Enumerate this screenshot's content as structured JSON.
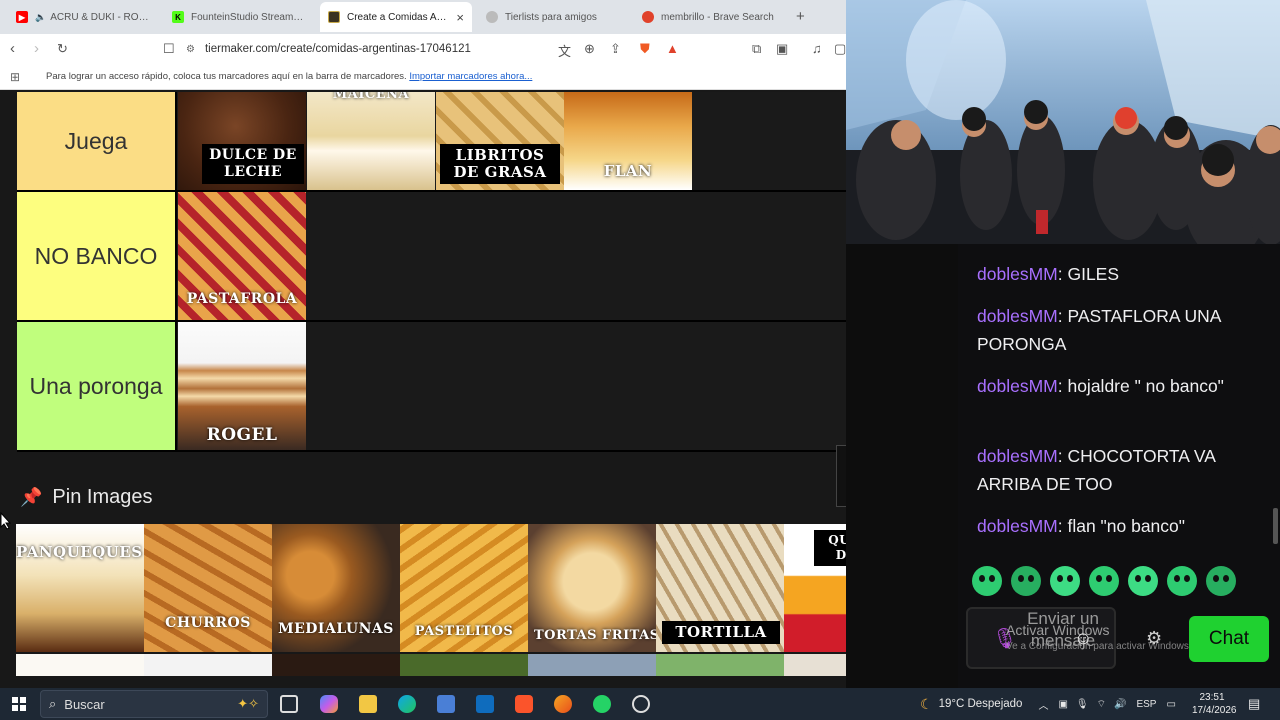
{
  "browser": {
    "tabs": [
      {
        "title": "ACRU & DUKI - ROSA N",
        "favicon_color": "#ff0000",
        "active": false
      },
      {
        "title": "FounteinStudio Stream - W",
        "favicon_color": "#53fc18",
        "active": false
      },
      {
        "title": "Create a Comidas Argen",
        "favicon_color": "#6b5b2e",
        "active": true
      },
      {
        "title": "Tierlists para amigos",
        "favicon_color": "#888888",
        "active": false
      },
      {
        "title": "membrillo - Brave Search",
        "favicon_color": "#e0422b",
        "active": false
      }
    ],
    "new_tab": "+",
    "close_tab": "×",
    "url": "tiermaker.com/create/comidas-argentinas-17046121",
    "bookmarks_hint": "Para lograr un acceso rápido, coloca tus marcadores aquí en la barra de marcadores.",
    "bookmarks_import": "Importar marcadores ahora..."
  },
  "tierlist": {
    "rows": [
      {
        "label": "Juega",
        "color": "#fbdd85",
        "items": [
          "DULCE DE LECHE",
          "MAICENA",
          "LIBRITOS DE GRASA",
          "FLAN"
        ]
      },
      {
        "label": "NO BANCO",
        "color": "#fdfe7f",
        "items": [
          "PASTAFROLA"
        ]
      },
      {
        "label": "Una poronga",
        "color": "#c0fe7d",
        "items": [
          "ROGEL"
        ]
      }
    ]
  },
  "pin_images": {
    "title": "Pin Images",
    "items": [
      "PANQUEQUES",
      "CHURROS",
      "MEDIALUNAS",
      "PASTELITOS",
      "TORTAS FRITAS",
      "TORTILLA",
      "QUESO Y DULCE"
    ]
  },
  "chat": {
    "messages": [
      {
        "user": "doblesMM",
        "text": "GILES"
      },
      {
        "user": "doblesMM",
        "text": "PASTAFLORA UNA PORONGA"
      },
      {
        "user": "doblesMM",
        "text": "hojaldre \" no banco\""
      },
      {
        "user": "doblesMM",
        "text": "CHOCOTORTA VA ARRIBA DE TOO"
      },
      {
        "user": "doblesMM",
        "text": "flan \"no banco\""
      }
    ],
    "input_placeholder": "Enviar un mensaje",
    "send_button": "Chat",
    "windows_watermark": "Activar Windows",
    "windows_watermark_sub": "Ve a Configuración para activar Windows."
  },
  "taskbar": {
    "search_placeholder": "Buscar",
    "weather": "19°C  Despejado",
    "language": "ESP",
    "time": "23:51",
    "date": "17/4/2026"
  }
}
